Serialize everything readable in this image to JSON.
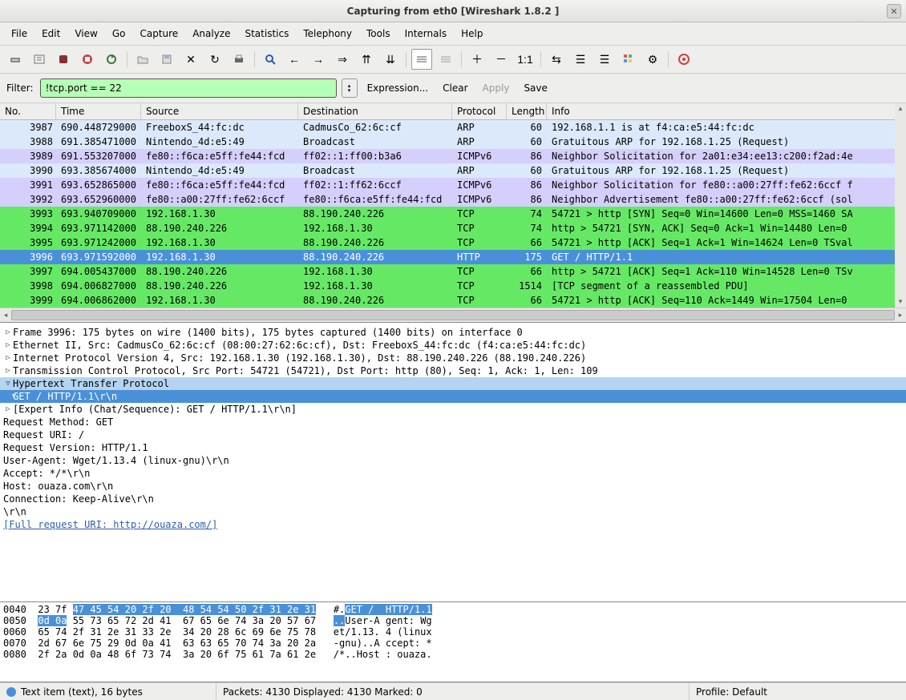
{
  "window": {
    "title": "Capturing from eth0    [Wireshark 1.8.2 ]"
  },
  "menus": [
    "File",
    "Edit",
    "View",
    "Go",
    "Capture",
    "Analyze",
    "Statistics",
    "Telephony",
    "Tools",
    "Internals",
    "Help"
  ],
  "filter": {
    "label": "Filter:",
    "value": "!tcp.port == 22",
    "expression": "Expression...",
    "clear": "Clear",
    "apply": "Apply",
    "save": "Save"
  },
  "columns": {
    "no": "No.",
    "time": "Time",
    "source": "Source",
    "destination": "Destination",
    "protocol": "Protocol",
    "length": "Length",
    "info": "Info"
  },
  "packets": [
    {
      "no": "3987",
      "time": "690.448729000",
      "src": "FreeboxS_44:fc:dc",
      "dst": "CadmusCo_62:6c:cf",
      "proto": "ARP",
      "len": "60",
      "info": "192.168.1.1 is at f4:ca:e5:44:fc:dc",
      "cls": "bg-lblue"
    },
    {
      "no": "3988",
      "time": "691.385471000",
      "src": "Nintendo_4d:e5:49",
      "dst": "Broadcast",
      "proto": "ARP",
      "len": "60",
      "info": "Gratuitous ARP for 192.168.1.25 (Request)",
      "cls": "bg-lblue"
    },
    {
      "no": "3989",
      "time": "691.553207000",
      "src": "fe80::f6ca:e5ff:fe44:fcd",
      "dst": "ff02::1:ff00:b3a6",
      "proto": "ICMPv6",
      "len": "86",
      "info": "Neighbor Solicitation for 2a01:e34:ee13:c200:f2ad:4e",
      "cls": "bg-purple"
    },
    {
      "no": "3990",
      "time": "693.385674000",
      "src": "Nintendo_4d:e5:49",
      "dst": "Broadcast",
      "proto": "ARP",
      "len": "60",
      "info": "Gratuitous ARP for 192.168.1.25 (Request)",
      "cls": "bg-lblue"
    },
    {
      "no": "3991",
      "time": "693.652865000",
      "src": "fe80::f6ca:e5ff:fe44:fcd",
      "dst": "ff02::1:ff62:6ccf",
      "proto": "ICMPv6",
      "len": "86",
      "info": "Neighbor Solicitation for fe80::a00:27ff:fe62:6ccf f",
      "cls": "bg-purple"
    },
    {
      "no": "3992",
      "time": "693.652960000",
      "src": "fe80::a00:27ff:fe62:6ccf",
      "dst": "fe80::f6ca:e5ff:fe44:fcd",
      "proto": "ICMPv6",
      "len": "86",
      "info": "Neighbor Advertisement fe80::a00:27ff:fe62:6ccf (sol",
      "cls": "bg-purple"
    },
    {
      "no": "3993",
      "time": "693.940709000",
      "src": "192.168.1.30",
      "dst": "88.190.240.226",
      "proto": "TCP",
      "len": "74",
      "info": "54721 > http [SYN] Seq=0 Win=14600 Len=0 MSS=1460 SA",
      "cls": "bg-green"
    },
    {
      "no": "3994",
      "time": "693.971142000",
      "src": "88.190.240.226",
      "dst": "192.168.1.30",
      "proto": "TCP",
      "len": "74",
      "info": "http > 54721 [SYN, ACK] Seq=0 Ack=1 Win=14480 Len=0 ",
      "cls": "bg-green"
    },
    {
      "no": "3995",
      "time": "693.971242000",
      "src": "192.168.1.30",
      "dst": "88.190.240.226",
      "proto": "TCP",
      "len": "66",
      "info": "54721 > http [ACK] Seq=1 Ack=1 Win=14624 Len=0 TSval",
      "cls": "bg-green"
    },
    {
      "no": "3996",
      "time": "693.971592000",
      "src": "192.168.1.30",
      "dst": "88.190.240.226",
      "proto": "HTTP",
      "len": "175",
      "info": "GET / HTTP/1.1",
      "cls": "bg-sel"
    },
    {
      "no": "3997",
      "time": "694.005437000",
      "src": "88.190.240.226",
      "dst": "192.168.1.30",
      "proto": "TCP",
      "len": "66",
      "info": "http > 54721 [ACK] Seq=1 Ack=110 Win=14528 Len=0 TSv",
      "cls": "bg-green"
    },
    {
      "no": "3998",
      "time": "694.006827000",
      "src": "88.190.240.226",
      "dst": "192.168.1.30",
      "proto": "TCP",
      "len": "1514",
      "info": "[TCP segment of a reassembled PDU]",
      "cls": "bg-green"
    },
    {
      "no": "3999",
      "time": "694.006862000",
      "src": "192.168.1.30",
      "dst": "88.190.240.226",
      "proto": "TCP",
      "len": "66",
      "info": "54721 > http [ACK] Seq=110 Ack=1449 Win=17504 Len=0 ",
      "cls": "bg-green"
    }
  ],
  "details": {
    "frame": "Frame 3996: 175 bytes on wire (1400 bits), 175 bytes captured (1400 bits) on interface 0",
    "eth": "Ethernet II, Src: CadmusCo_62:6c:cf (08:00:27:62:6c:cf), Dst: FreeboxS_44:fc:dc (f4:ca:e5:44:fc:dc)",
    "ip": "Internet Protocol Version 4, Src: 192.168.1.30 (192.168.1.30), Dst: 88.190.240.226 (88.190.240.226)",
    "tcp": "Transmission Control Protocol, Src Port: 54721 (54721), Dst Port: http (80), Seq: 1, Ack: 1, Len: 109",
    "http": "Hypertext Transfer Protocol",
    "get": "GET / HTTP/1.1\\r\\n",
    "expert": "[Expert Info (Chat/Sequence): GET / HTTP/1.1\\r\\n]",
    "method": "Request Method: GET",
    "uri": "Request URI: /",
    "version": "Request Version: HTTP/1.1",
    "ua": "User-Agent: Wget/1.13.4 (linux-gnu)\\r\\n",
    "accept": "Accept: */*\\r\\n",
    "host": "Host: ouaza.com\\r\\n",
    "conn": "Connection: Keep-Alive\\r\\n",
    "crlf": "\\r\\n",
    "fulluri": "[Full request URI: http://ouaza.com/]"
  },
  "hex": [
    {
      "off": "0040",
      "h1": "23 7f ",
      "h2": "47 45 54 20 2f 20  48 54 54 50 2f 31 2e 31",
      "a1": "#.",
      "a2": "GET /  HTTP/1.1"
    },
    {
      "off": "0050",
      "h1": "",
      "h2": "0d 0a",
      "h3": " 55 73 65 72 2d 41  67 65 6e 74 3a 20 57 67",
      "a1": "",
      "a2": "..",
      "a3": "User-A gent: Wg"
    },
    {
      "off": "0060",
      "h1": "65 74 2f 31 2e 31 33 2e  34 20 28 6c 69 6e 75 78",
      "a1": "et/1.13. 4 (linux"
    },
    {
      "off": "0070",
      "h1": "2d 67 6e 75 29 0d 0a 41  63 63 65 70 74 3a 20 2a",
      "a1": "-gnu)..A ccept: *"
    },
    {
      "off": "0080",
      "h1": "2f 2a 0d 0a 48 6f 73 74  3a 20 6f 75 61 7a 61 2e",
      "a1": "/*..Host : ouaza."
    }
  ],
  "status": {
    "left": "Text item (text), 16 bytes",
    "mid": "Packets: 4130 Displayed: 4130 Marked: 0",
    "right": "Profile: Default"
  }
}
